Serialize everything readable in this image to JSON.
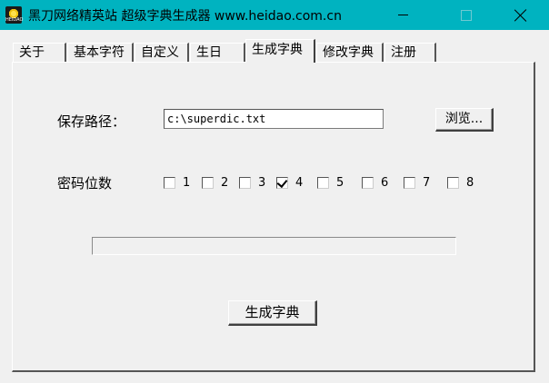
{
  "window": {
    "title": "黑刀网络精英站 超级字典生成器 www.heidao.com.cn",
    "icon_text": "HEIDAO"
  },
  "tabs": [
    {
      "label": "关于"
    },
    {
      "label": "基本字符"
    },
    {
      "label": "自定义"
    },
    {
      "label": "生日"
    },
    {
      "label": "生成字典",
      "active": true
    },
    {
      "label": "修改字典"
    },
    {
      "label": "注册"
    }
  ],
  "form": {
    "path_label": "保存路径：",
    "path_value": "c:\\superdic.txt",
    "browse_label": "浏览...",
    "digits_label": "密码位数",
    "digits": [
      {
        "label": "1",
        "checked": false
      },
      {
        "label": "2",
        "checked": false
      },
      {
        "label": "3",
        "checked": false
      },
      {
        "label": "4",
        "checked": true
      },
      {
        "label": "5",
        "checked": false
      },
      {
        "label": "6",
        "checked": false
      },
      {
        "label": "7",
        "checked": false
      },
      {
        "label": "8",
        "checked": false
      }
    ],
    "progress": 0,
    "generate_label": "生成字典"
  }
}
